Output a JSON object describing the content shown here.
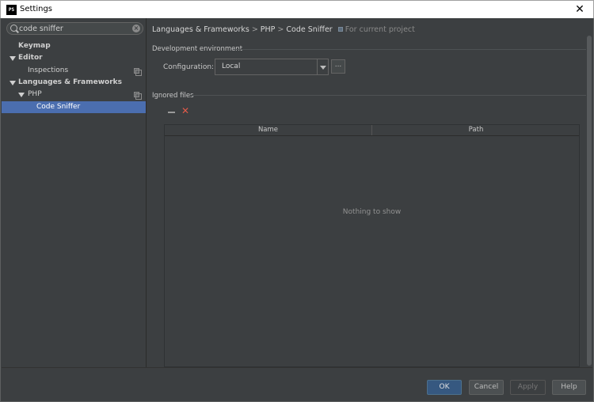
{
  "window": {
    "title": "Settings",
    "app_icon": "PS"
  },
  "search": {
    "value": "code sniffer"
  },
  "tree": [
    {
      "label": "Keymap",
      "bold": true,
      "level": 0,
      "expanded": null,
      "project_scope": false,
      "selected": false
    },
    {
      "label": "Editor",
      "bold": true,
      "level": 0,
      "expanded": true,
      "project_scope": false,
      "selected": false
    },
    {
      "label": "Inspections",
      "bold": false,
      "level": 1,
      "expanded": null,
      "project_scope": true,
      "selected": false
    },
    {
      "label": "Languages & Frameworks",
      "bold": true,
      "level": 0,
      "expanded": true,
      "project_scope": false,
      "selected": false
    },
    {
      "label": "PHP",
      "bold": false,
      "level": 1,
      "expanded": true,
      "project_scope": true,
      "selected": false
    },
    {
      "label": "Code Sniffer",
      "bold": false,
      "level": 2,
      "expanded": null,
      "project_scope": false,
      "selected": true
    }
  ],
  "breadcrumb": {
    "items": [
      "Languages & Frameworks",
      "PHP",
      "Code Sniffer"
    ],
    "separator": ">",
    "scope": "For current project"
  },
  "dev_env": {
    "title": "Development environment",
    "config_label": "Configuration:",
    "config_value": "Local",
    "more_button": "..."
  },
  "ignored": {
    "title": "Ignored files",
    "columns": [
      "Name",
      "Path"
    ],
    "rows": [],
    "empty_text": "Nothing to show"
  },
  "buttons": {
    "ok": "OK",
    "cancel": "Cancel",
    "apply": "Apply",
    "help": "Help"
  },
  "colors": {
    "background": "#3c3f41",
    "selection": "#4b6eaf",
    "ok_button": "#365880",
    "remove_icon": "#e05a4a"
  }
}
